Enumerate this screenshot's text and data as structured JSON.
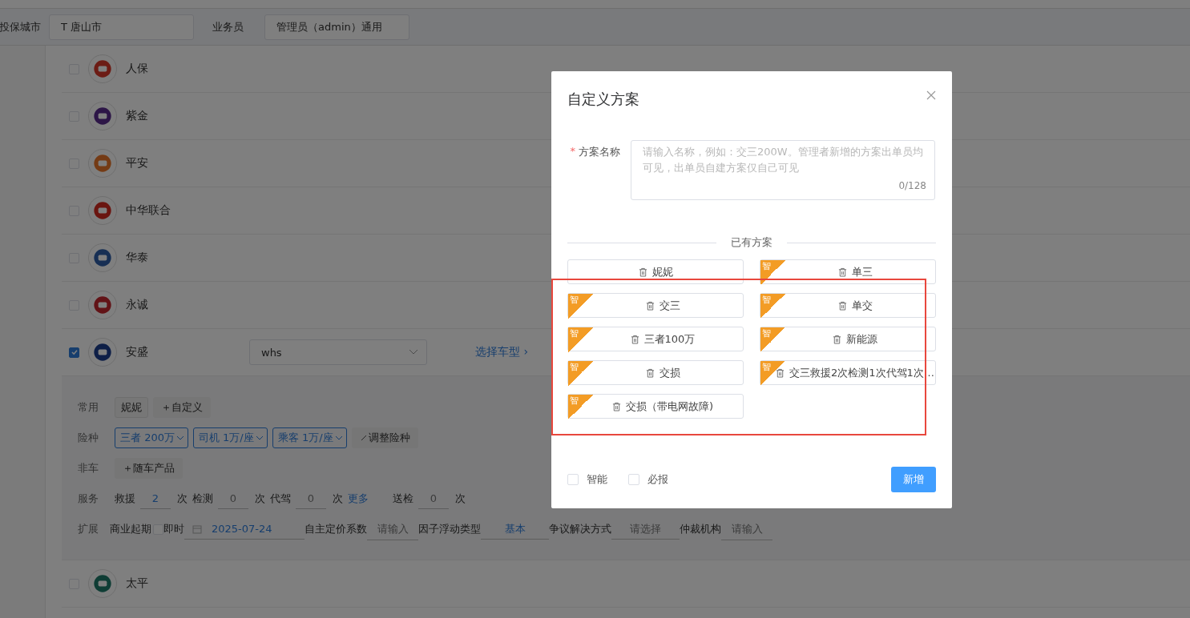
{
  "filter_bar": {
    "city_label": "投保城市",
    "city": "T 唐山市",
    "agent_label": "业务员",
    "agent": "管理员（admin）通用"
  },
  "insurers": [
    {
      "name": "人保",
      "checked": false
    },
    {
      "name": "紫金",
      "checked": false
    },
    {
      "name": "平安",
      "checked": false
    },
    {
      "name": "中华联合",
      "checked": false
    },
    {
      "name": "华泰",
      "checked": false
    },
    {
      "name": "永诚",
      "checked": false
    },
    {
      "name": "安盛",
      "checked": true,
      "vehicle_select": "whs",
      "link": "选择车型 ›"
    },
    {
      "name": "太平",
      "checked": false
    }
  ],
  "config": {
    "common": {
      "label": "常用",
      "chips": [
        "妮妮"
      ],
      "add": "＋自定义"
    },
    "coverage": {
      "label": "险种",
      "selects": [
        "三者 200万",
        "司机 1万/座",
        "乘客 1万/座"
      ],
      "adjust": "调整险种"
    },
    "non_vehicle": {
      "label": "非车",
      "add": "＋随车产品"
    },
    "services": {
      "label": "服务",
      "items": [
        {
          "name": "救援",
          "value": "2",
          "unit": "次"
        },
        {
          "name": "检测",
          "placeholder": "0",
          "unit": "次"
        },
        {
          "name": "代驾",
          "placeholder": "0",
          "unit": "次",
          "more": "更多"
        },
        {
          "name": "送检",
          "placeholder": "0",
          "unit": "次"
        }
      ]
    },
    "extension": {
      "label": "扩展",
      "fields": [
        {
          "kind": "date",
          "label": "商业起期",
          "checkbox_label": "即时",
          "checked": false,
          "value": "2025-07-24"
        },
        {
          "kind": "input",
          "label": "自主定价系数",
          "placeholder": "请输入"
        },
        {
          "kind": "select",
          "label": "因子浮动类型",
          "value": "基本"
        },
        {
          "kind": "select",
          "label": "争议解决方式",
          "placeholder": "请选择"
        },
        {
          "kind": "input",
          "label": "仲裁机构",
          "placeholder": "请输入"
        }
      ]
    }
  },
  "dialog": {
    "title": "自定义方案",
    "name_label": "方案名称",
    "required_mark": "*",
    "placeholder": "请输入名称，例如：交三200W。管理者新增的方案出单员均可见，出单员自建方案仅自己可见",
    "counter": "0/128",
    "divider": "已有方案",
    "plans": [
      {
        "name": "妮妮"
      },
      {
        "name": "单三",
        "badge": "智"
      },
      {
        "name": "交三",
        "badge": "智"
      },
      {
        "name": "单交",
        "badge": "智"
      },
      {
        "name": "三者100万",
        "badge": "智"
      },
      {
        "name": "新能源",
        "badge": "智"
      },
      {
        "name": "交损",
        "badge": "智"
      },
      {
        "name": "交三救援2次检测1次代驾1次…",
        "badge": "智"
      },
      {
        "name": "交损（带电网故障)",
        "badge": "智"
      }
    ],
    "checkboxes": [
      {
        "label": "智能",
        "checked": false
      },
      {
        "label": "必报",
        "checked": false
      }
    ],
    "submit": "新增"
  }
}
